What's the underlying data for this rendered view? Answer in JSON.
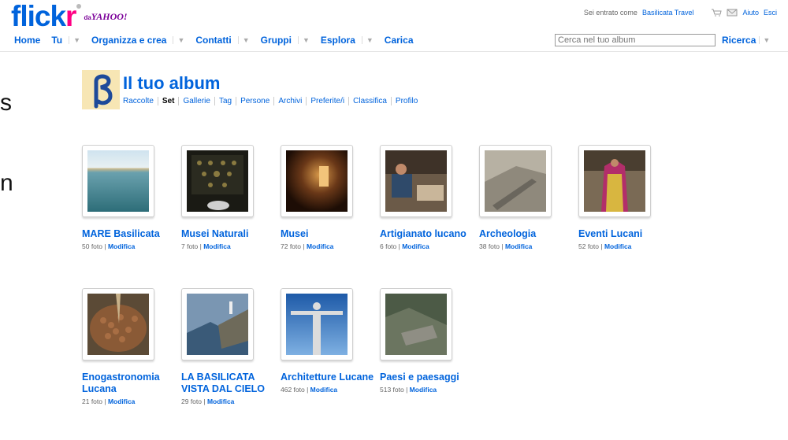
{
  "header": {
    "logo_main": "flick",
    "logo_r": "r",
    "logo_da": "da",
    "logo_yahoo": "YAHOO!",
    "signed_in_text": "Sei entrato come",
    "user_name": "Basilicata Travel",
    "help": "Aiuto",
    "logout": "Esci"
  },
  "nav": {
    "home": "Home",
    "tu": "Tu",
    "organizza": "Organizza e crea",
    "contatti": "Contatti",
    "gruppi": "Gruppi",
    "esplora": "Esplora",
    "carica": "Carica"
  },
  "search": {
    "placeholder": "Cerca nel tuo album",
    "button": "Ricerca"
  },
  "fragments": {
    "f1": "s",
    "f2": "n"
  },
  "album": {
    "title": "Il tuo album",
    "subnav": [
      "Raccolte",
      "Set",
      "Gallerie",
      "Tag",
      "Persone",
      "Archivi",
      "Preferite/i",
      "Classifica",
      "Profilo"
    ]
  },
  "sets": [
    {
      "title": "MARE Basilicata",
      "count": "50 foto",
      "edit": "Modifica"
    },
    {
      "title": "Musei Naturali",
      "count": "7 foto",
      "edit": "Modifica"
    },
    {
      "title": "Musei",
      "count": "72 foto",
      "edit": "Modifica"
    },
    {
      "title": "Artigianato lucano",
      "count": "6 foto",
      "edit": "Modifica"
    },
    {
      "title": "Archeologia",
      "count": "38 foto",
      "edit": "Modifica"
    },
    {
      "title": "Eventi Lucani",
      "count": "52 foto",
      "edit": "Modifica"
    },
    {
      "title": "Enogastronomia Lucana",
      "count": "21 foto",
      "edit": "Modifica"
    },
    {
      "title": "LA BASILICATA VISTA DAL CIELO",
      "count": "29 foto",
      "edit": "Modifica"
    },
    {
      "title": "Architetture Lucane",
      "count": "462 foto",
      "edit": "Modifica"
    },
    {
      "title": "Paesi e paesaggi",
      "count": "513 foto",
      "edit": "Modifica"
    }
  ],
  "colors": {
    "link": "#0063dc",
    "flickr_pink": "#ff0084",
    "yahoo_purple": "#7b0099"
  }
}
